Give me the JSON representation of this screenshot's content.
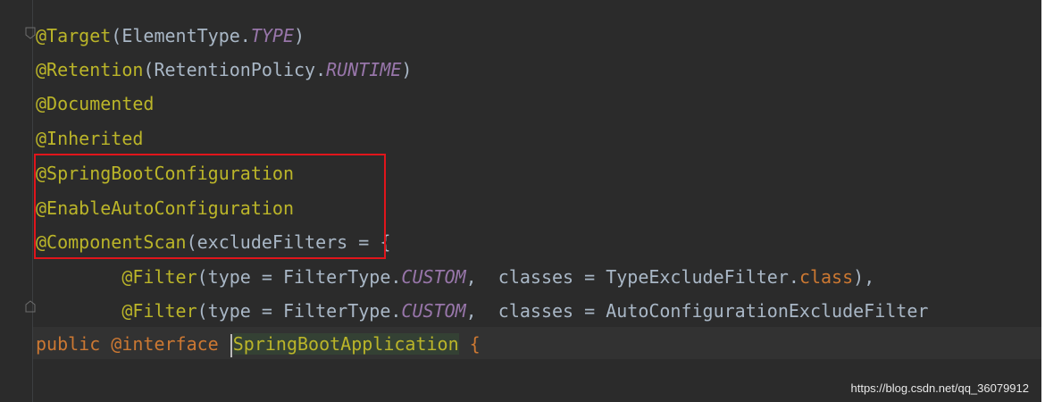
{
  "code": {
    "line1": {
      "ann": "@Target",
      "open": "(ElementType.",
      "const": "TYPE",
      "close": ")"
    },
    "line2": {
      "ann": "@Retention",
      "open": "(RetentionPolicy.",
      "const": "RUNTIME",
      "close": ")"
    },
    "line3": {
      "ann": "@Documented"
    },
    "line4": {
      "ann": "@Inherited"
    },
    "line5": {
      "ann": "@SpringBootConfiguration"
    },
    "line6": {
      "ann": "@EnableAutoConfiguration"
    },
    "line7": {
      "ann": "@ComponentScan",
      "rest": "(excludeFilters = {"
    },
    "line8": {
      "indent": "        ",
      "ann": "@Filter",
      "mid": "(type = FilterType.",
      "const": "CUSTOM",
      "rest": ",  classes = TypeExcludeFilter.",
      "kw": "class",
      "end": "),"
    },
    "line9": {
      "indent": "        ",
      "ann": "@Filter",
      "mid": "(type = FilterType.",
      "const": "CUSTOM",
      "rest": ",  classes = AutoConfigurationExcludeFilter"
    },
    "line10": {
      "kw1": "public",
      "sp1": " ",
      "kw2": "@interface",
      "sp2": " ",
      "ident": "SpringBootApplication",
      "brace": " {"
    }
  },
  "watermark": "https://blog.csdn.net/qq_36079912",
  "colors": {
    "background": "#2b2b2b",
    "annotation": "#bbb529",
    "keyword": "#cc7832",
    "static_field": "#9876aa",
    "text": "#a9b7c6",
    "highlight_box": "#e0151b"
  }
}
